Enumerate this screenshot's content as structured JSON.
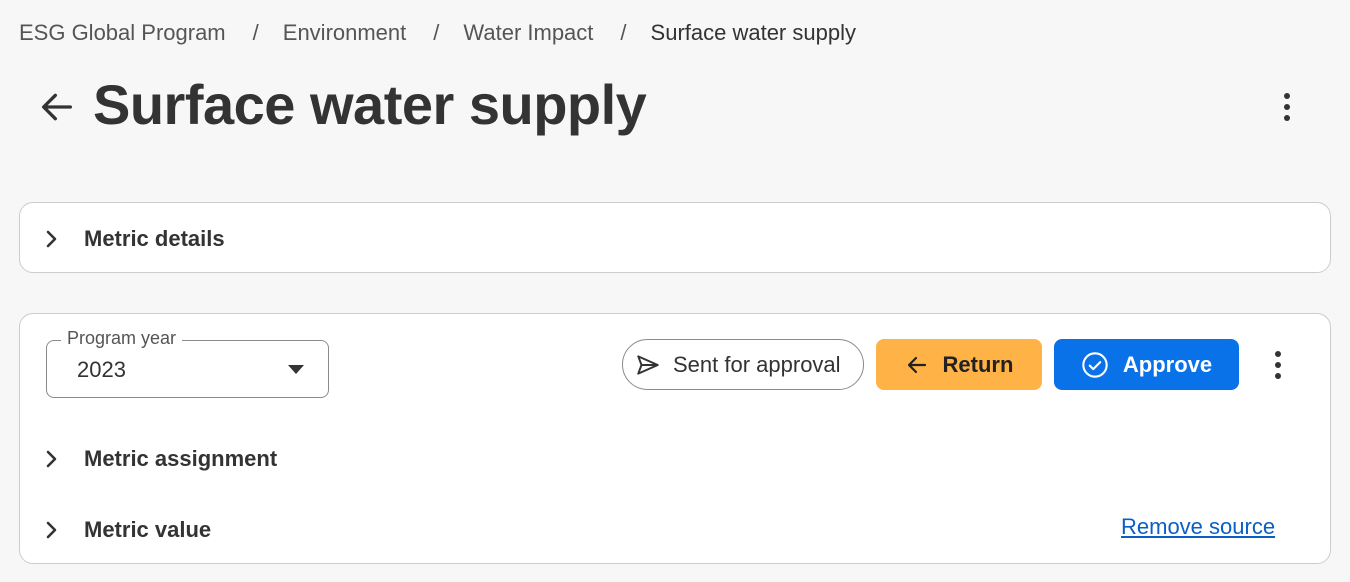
{
  "breadcrumb": {
    "items": [
      "ESG Global Program",
      "Environment",
      "Water Impact"
    ],
    "separator": "/",
    "current": "Surface water supply"
  },
  "header": {
    "title": "Surface water supply",
    "back_icon": "arrow-left-icon",
    "menu_icon": "more-vertical-icon"
  },
  "metric_details": {
    "label": "Metric details",
    "icon": "chevron-right-icon"
  },
  "program_year": {
    "label": "Program year",
    "value": "2023",
    "icon": "caret-down-icon"
  },
  "status": {
    "label": "Sent for approval",
    "icon": "send-icon"
  },
  "actions": {
    "return_label": "Return",
    "return_icon": "arrow-left-icon",
    "approve_label": "Approve",
    "approve_icon": "check-circle-icon",
    "menu_icon": "more-vertical-icon"
  },
  "sections": {
    "assignment_label": "Metric assignment",
    "value_label": "Metric value",
    "remove_source_label": "Remove source"
  },
  "colors": {
    "return": "#ffb347",
    "approve": "#0a72e8",
    "link": "#0a5fc4",
    "background": "#f7f7f7"
  }
}
